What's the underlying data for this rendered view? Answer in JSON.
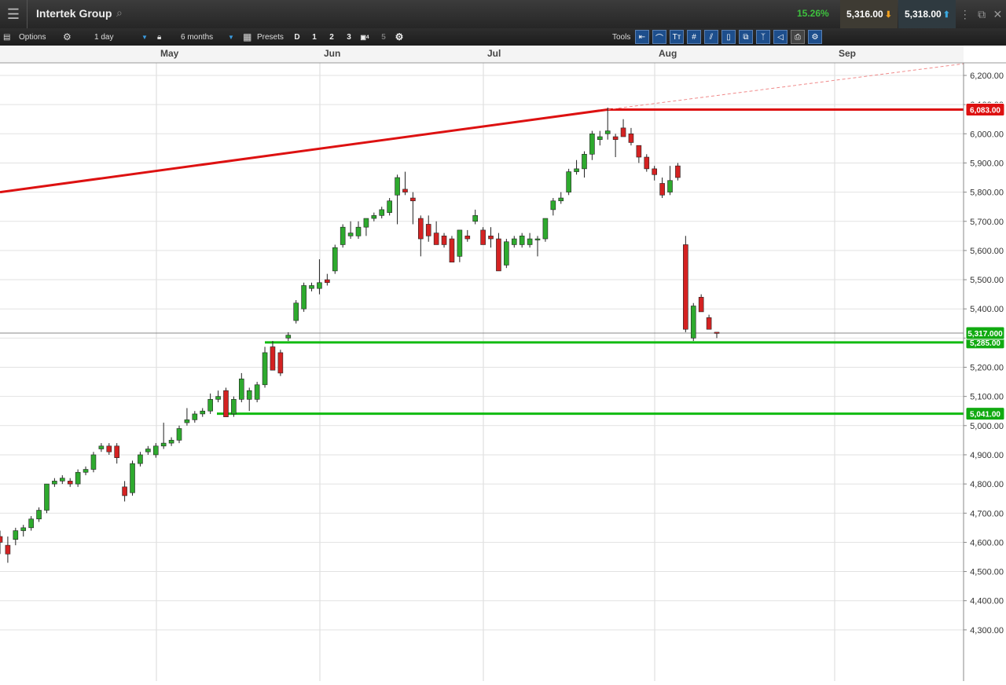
{
  "header": {
    "menu_icon": "hamburger-icon",
    "title": "Intertek Group",
    "search_icon": "search-icon",
    "change_pct": "15.26%",
    "sell_price": "5,316.00",
    "buy_price": "5,318.00",
    "colors": {
      "change": "#3ec13e",
      "sell_arrow": "#f0a020",
      "buy_arrow": "#3aa8e0"
    }
  },
  "toolbar": {
    "options_label": "Options",
    "interval_value": "1 day",
    "range_value": "6 months",
    "presets_label": "Presets",
    "preset_d": "D",
    "preset_1": "1",
    "preset_2": "2",
    "preset_3": "3",
    "preset_4": "4",
    "preset_5": "5",
    "tools_label": "Tools"
  },
  "chart_data": {
    "type": "candlestick",
    "months": [
      "May",
      "Jun",
      "Jul",
      "Aug",
      "Sep"
    ],
    "y_ticks": [
      "6,200.00",
      "6,100.00",
      "6,000.00",
      "5,900.00",
      "5,800.00",
      "5,700.00",
      "5,600.00",
      "5,500.00",
      "5,400.00",
      "5,300.00",
      "5,200.00",
      "5,100.00",
      "5,000.00",
      "4,900.00",
      "4,800.00",
      "4,700.00",
      "4,600.00",
      "4,500.00",
      "4,400.00",
      "4,300.00"
    ],
    "ylim": [
      4300,
      6240
    ],
    "markers": {
      "red_line": "6,083.00",
      "last": "5,317.000",
      "green_upper": "5,285.00",
      "green_lower": "5,041.00"
    },
    "colors": {
      "up": "#2eaa2e",
      "down": "#d42222",
      "resistance": "#dd1111",
      "support": "#11bb11"
    },
    "candles": [
      [
        4620,
        4640,
        4560,
        4600
      ],
      [
        4590,
        4620,
        4530,
        4560
      ],
      [
        4610,
        4650,
        4590,
        4640
      ],
      [
        4640,
        4660,
        4620,
        4650
      ],
      [
        4650,
        4690,
        4640,
        4680
      ],
      [
        4680,
        4720,
        4670,
        4710
      ],
      [
        4710,
        4800,
        4700,
        4800
      ],
      [
        4800,
        4820,
        4790,
        4810
      ],
      [
        4810,
        4830,
        4800,
        4820
      ],
      [
        4810,
        4820,
        4790,
        4800
      ],
      [
        4800,
        4850,
        4790,
        4840
      ],
      [
        4840,
        4860,
        4830,
        4850
      ],
      [
        4850,
        4910,
        4840,
        4900
      ],
      [
        4920,
        4940,
        4910,
        4930
      ],
      [
        4930,
        4940,
        4900,
        4910
      ],
      [
        4930,
        4940,
        4870,
        4890
      ],
      [
        4790,
        4810,
        4740,
        4760
      ],
      [
        4770,
        4880,
        4760,
        4870
      ],
      [
        4870,
        4910,
        4860,
        4900
      ],
      [
        4910,
        4930,
        4900,
        4920
      ],
      [
        4900,
        4940,
        4890,
        4930
      ],
      [
        4930,
        5010,
        4920,
        4940
      ],
      [
        4940,
        4960,
        4930,
        4950
      ],
      [
        4950,
        5000,
        4940,
        4990
      ],
      [
        5010,
        5060,
        5000,
        5020
      ],
      [
        5020,
        5050,
        5010,
        5040
      ],
      [
        5040,
        5060,
        5030,
        5050
      ],
      [
        5050,
        5110,
        5040,
        5090
      ],
      [
        5090,
        5120,
        5080,
        5100
      ],
      [
        5120,
        5130,
        5030,
        5030
      ],
      [
        5040,
        5100,
        5030,
        5090
      ],
      [
        5090,
        5180,
        5080,
        5160
      ],
      [
        5090,
        5130,
        5050,
        5120
      ],
      [
        5090,
        5150,
        5080,
        5140
      ],
      [
        5140,
        5270,
        5130,
        5250
      ],
      [
        5270,
        5290,
        5200,
        5190
      ],
      [
        5250,
        5260,
        5170,
        5180
      ],
      [
        5300,
        5320,
        5290,
        5310
      ],
      [
        5360,
        5430,
        5350,
        5420
      ],
      [
        5400,
        5490,
        5390,
        5480
      ],
      [
        5470,
        5490,
        5460,
        5480
      ],
      [
        5470,
        5570,
        5450,
        5490
      ],
      [
        5500,
        5520,
        5480,
        5490
      ],
      [
        5530,
        5620,
        5520,
        5610
      ],
      [
        5620,
        5690,
        5610,
        5680
      ],
      [
        5650,
        5700,
        5640,
        5660
      ],
      [
        5650,
        5700,
        5640,
        5680
      ],
      [
        5680,
        5710,
        5650,
        5710
      ],
      [
        5710,
        5730,
        5700,
        5720
      ],
      [
        5720,
        5750,
        5710,
        5740
      ],
      [
        5730,
        5780,
        5720,
        5770
      ],
      [
        5790,
        5860,
        5690,
        5850
      ],
      [
        5810,
        5870,
        5790,
        5800
      ],
      [
        5780,
        5800,
        5690,
        5770
      ],
      [
        5710,
        5720,
        5580,
        5640
      ],
      [
        5690,
        5720,
        5630,
        5650
      ],
      [
        5660,
        5700,
        5620,
        5620
      ],
      [
        5650,
        5660,
        5610,
        5620
      ],
      [
        5640,
        5650,
        5560,
        5560
      ],
      [
        5580,
        5670,
        5560,
        5670
      ],
      [
        5650,
        5670,
        5630,
        5640
      ],
      [
        5700,
        5740,
        5690,
        5720
      ],
      [
        5670,
        5680,
        5620,
        5620
      ],
      [
        5650,
        5680,
        5610,
        5640
      ],
      [
        5640,
        5660,
        5530,
        5530
      ],
      [
        5550,
        5640,
        5540,
        5630
      ],
      [
        5620,
        5650,
        5610,
        5640
      ],
      [
        5620,
        5660,
        5610,
        5650
      ],
      [
        5620,
        5660,
        5610,
        5640
      ],
      [
        5640,
        5650,
        5580,
        5640
      ],
      [
        5640,
        5710,
        5630,
        5710
      ],
      [
        5740,
        5780,
        5720,
        5770
      ],
      [
        5770,
        5800,
        5760,
        5780
      ],
      [
        5800,
        5880,
        5790,
        5870
      ],
      [
        5870,
        5910,
        5860,
        5880
      ],
      [
        5880,
        5940,
        5850,
        5930
      ],
      [
        5930,
        6010,
        5910,
        6000
      ],
      [
        5980,
        6010,
        5960,
        5990
      ],
      [
        6000,
        6090,
        5980,
        6010
      ],
      [
        5990,
        6000,
        5920,
        5980
      ],
      [
        6020,
        6050,
        6010,
        5990
      ],
      [
        6000,
        6020,
        5960,
        5970
      ],
      [
        5960,
        5960,
        5900,
        5920
      ],
      [
        5920,
        5930,
        5870,
        5880
      ],
      [
        5880,
        5890,
        5840,
        5860
      ],
      [
        5830,
        5850,
        5780,
        5790
      ],
      [
        5800,
        5890,
        5790,
        5840
      ],
      [
        5890,
        5900,
        5840,
        5850
      ],
      [
        5620,
        5650,
        5320,
        5330
      ],
      [
        5300,
        5420,
        5290,
        5410
      ],
      [
        5440,
        5450,
        5390,
        5390
      ],
      [
        5370,
        5380,
        5330,
        5330
      ],
      [
        5320,
        5320,
        5300,
        5317
      ]
    ]
  }
}
